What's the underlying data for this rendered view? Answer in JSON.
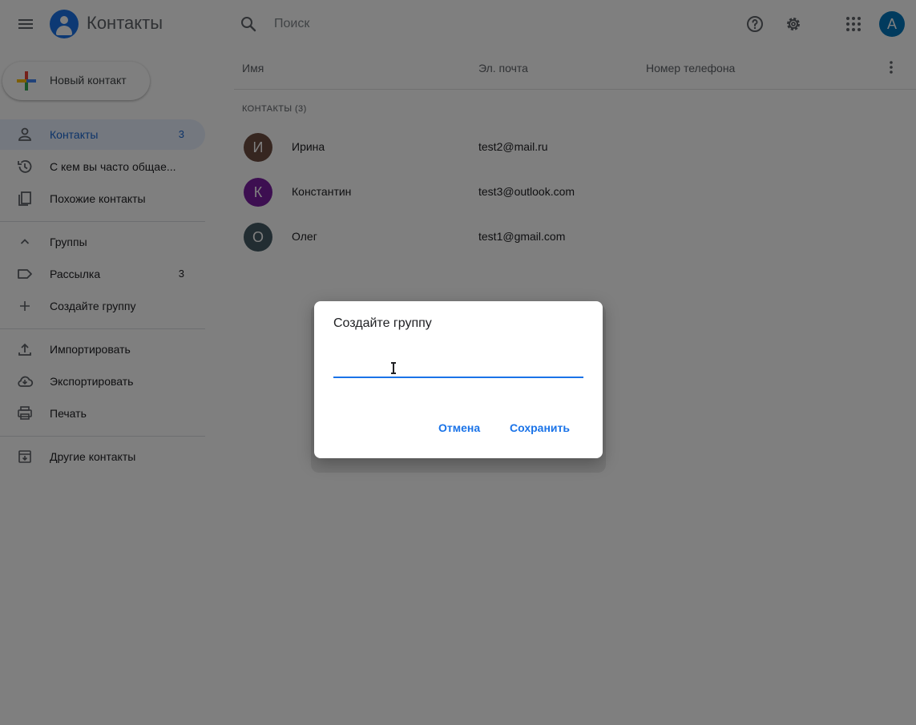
{
  "header": {
    "app_title": "Контакты",
    "search_placeholder": "Поиск",
    "account_initial": "A"
  },
  "sidebar": {
    "new_contact_label": "Новый контакт",
    "items": [
      {
        "label": "Контакты",
        "count": "3",
        "icon": "person-icon",
        "active": true
      },
      {
        "label": "С кем вы часто общае...",
        "icon": "history-icon"
      },
      {
        "label": "Похожие контакты",
        "icon": "copy-icon"
      }
    ],
    "groups_label": "Группы",
    "group_items": [
      {
        "label": "Рассылка",
        "count": "3",
        "icon": "label-icon"
      },
      {
        "label": "Создайте группу",
        "icon": "plus-icon"
      }
    ],
    "tools": [
      {
        "label": "Импортировать",
        "icon": "upload-icon"
      },
      {
        "label": "Экспортировать",
        "icon": "cloud-download-icon"
      },
      {
        "label": "Печать",
        "icon": "print-icon"
      }
    ],
    "other_contacts_label": "Другие контакты"
  },
  "list": {
    "columns": [
      "Имя",
      "Эл. почта",
      "Номер телефона"
    ],
    "section_label": "КОНТАКТЫ (3)",
    "rows": [
      {
        "initial": "И",
        "name": "Ирина",
        "email": "test2@mail.ru",
        "color": "#6d4c41"
      },
      {
        "initial": "К",
        "name": "Константин",
        "email": "test3@outlook.com",
        "color": "#7b1fa2"
      },
      {
        "initial": "О",
        "name": "Олег",
        "email": "test1@gmail.com",
        "color": "#455a64"
      }
    ]
  },
  "dialog": {
    "title": "Создайте группу",
    "input_value": "",
    "cancel_label": "Отмена",
    "save_label": "Сохранить"
  },
  "colors": {
    "accent": "#1a73e8",
    "active_nav_bg": "#e8f0fe",
    "overlay": "rgba(0,0,0,0.5)"
  }
}
